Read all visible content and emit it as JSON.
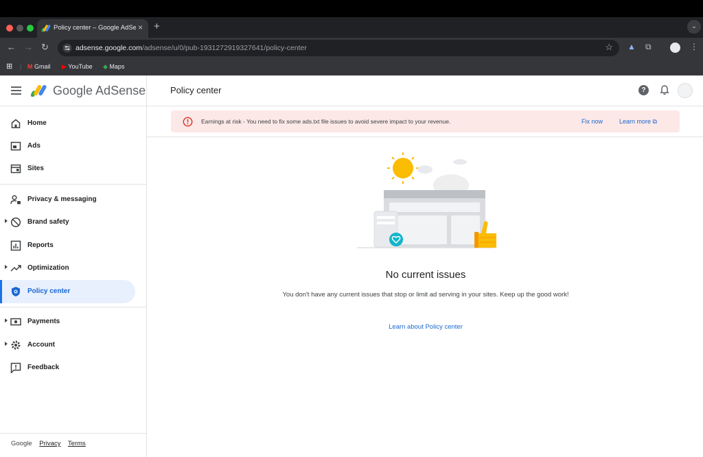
{
  "browser": {
    "tab_title": "Policy center – Google AdSense",
    "url_host": "adsense.google.com",
    "url_path": "/adsense/u/0/pub-1931272919327641/policy-center",
    "bookmarks": [
      "Gmail",
      "YouTube",
      "Maps"
    ]
  },
  "app": {
    "brand": "Google AdSense",
    "page_title": "Policy center",
    "help_glyph": "?"
  },
  "sidebar": {
    "items": [
      {
        "label": "Home",
        "icon": "home-icon"
      },
      {
        "label": "Ads",
        "icon": "ads-icon"
      },
      {
        "label": "Sites",
        "icon": "sites-icon"
      },
      {
        "label": "Privacy & messaging",
        "icon": "privacy-icon"
      },
      {
        "label": "Brand safety",
        "icon": "block-icon"
      },
      {
        "label": "Reports",
        "icon": "reports-icon"
      },
      {
        "label": "Optimization",
        "icon": "trending-icon"
      },
      {
        "label": "Policy center",
        "icon": "shield-icon",
        "active": true
      },
      {
        "label": "Payments",
        "icon": "payments-icon"
      },
      {
        "label": "Account",
        "icon": "gear-icon"
      },
      {
        "label": "Feedback",
        "icon": "feedback-icon"
      }
    ],
    "footer": {
      "google": "Google",
      "privacy": "Privacy",
      "terms": "Terms"
    }
  },
  "banner": {
    "text": "Earnings at risk - You need to fix some ads.txt file issues to avoid severe impact to your revenue.",
    "fix_label": "Fix now",
    "learn_label": "Learn more"
  },
  "empty_state": {
    "title": "No current issues",
    "description": "You don't have any current issues that stop or limit ad serving in your sites. Keep up the good work!",
    "link": "Learn about Policy center"
  },
  "colors": {
    "accent": "#1a73e8",
    "banner_bg": "#fce8e6",
    "error": "#d93025",
    "active_bg": "#e8f0fe"
  }
}
